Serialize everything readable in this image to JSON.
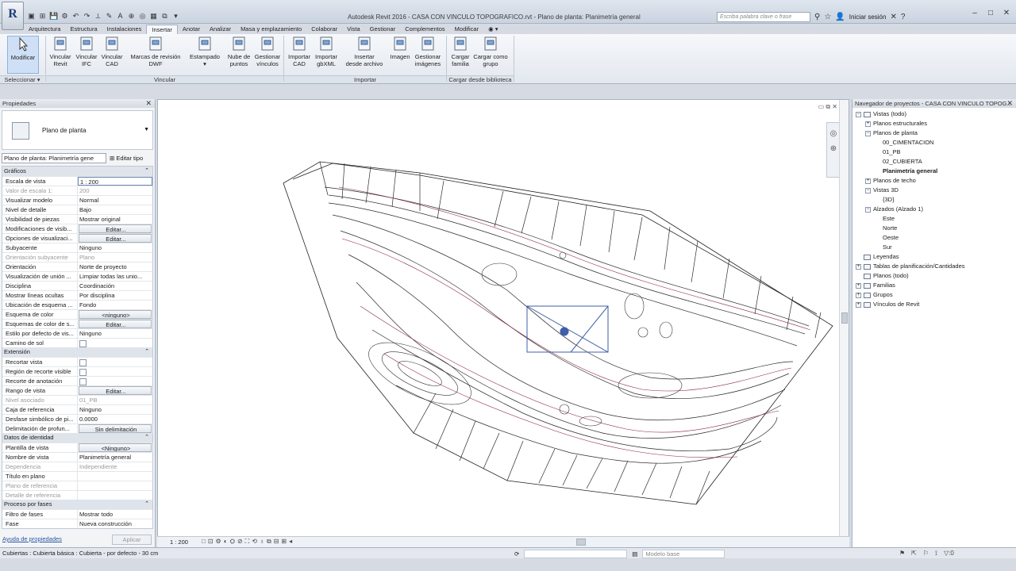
{
  "window": {
    "title": "Autodesk Revit 2016 -   CASA CON VINCULO TOPOGRAFICO.rvt - Plano de planta: Planimetría general",
    "logo": "R",
    "search_placeholder": "Escriba palabra clave o frase",
    "signin": "Iniciar sesión",
    "help": "?",
    "min": "–",
    "max": "□",
    "close": "✕"
  },
  "qat": [
    "▣",
    "⊞",
    "💾",
    "⚙",
    "↶",
    "↷",
    "⟂",
    "✎",
    "A",
    "⊕",
    "◎",
    "▦",
    "⧉",
    "▾"
  ],
  "tr_icons": [
    "⚲",
    "☆",
    "👤"
  ],
  "tabs": [
    "Arquitectura",
    "Estructura",
    "Instalaciones",
    "Insertar",
    "Anotar",
    "Analizar",
    "Masa y emplazamiento",
    "Colaborar",
    "Vista",
    "Gestionar",
    "Complementos",
    "Modificar",
    "◉ ▾"
  ],
  "active_tab": "Insertar",
  "ribbon": {
    "modify": "Modificar",
    "select_label": "Seleccionar ▾",
    "buttons": [
      {
        "l1": "Vincular",
        "l2": "Revit",
        "icon": "link-revit-icon"
      },
      {
        "l1": "Vincular",
        "l2": "IFC",
        "icon": "link-ifc-icon"
      },
      {
        "l1": "Vincular",
        "l2": "CAD",
        "icon": "link-cad-icon"
      },
      {
        "l1": "Marcas de revisión",
        "l2": "DWF",
        "icon": "dwf-markups-icon"
      },
      {
        "l1": "Estampado",
        "l2": "▾",
        "icon": "decal-icon"
      },
      {
        "l1": "Nube de",
        "l2": "puntos",
        "icon": "point-cloud-icon"
      },
      {
        "l1": "Gestionar",
        "l2": "vínculos",
        "icon": "manage-links-icon"
      },
      {
        "l1": "Importar",
        "l2": "CAD",
        "icon": "import-cad-icon"
      },
      {
        "l1": "Importar",
        "l2": "gbXML",
        "icon": "import-gbxml-icon"
      },
      {
        "l1": "Insertar",
        "l2": "desde archivo",
        "icon": "insert-file-icon"
      },
      {
        "l1": "Imagen",
        "l2": "",
        "icon": "image-icon"
      },
      {
        "l1": "Gestionar",
        "l2": "imágenes",
        "icon": "manage-images-icon"
      },
      {
        "l1": "Cargar",
        "l2": "familia",
        "icon": "load-family-icon"
      },
      {
        "l1": "Cargar como",
        "l2": "grupo",
        "icon": "load-group-icon"
      }
    ],
    "panels": {
      "vincular": "Vincular",
      "importar": "Importar",
      "cargar": "Cargar desde biblioteca"
    }
  },
  "properties": {
    "header": "Propiedades",
    "close": "✕",
    "type_name": "Plano de planta",
    "instance": "Plano de planta: Planimetría gene",
    "edit_type": "Editar tipo",
    "groups": [
      {
        "name": "Gráficos",
        "rows": [
          [
            "Escala de vista",
            "1 : 200",
            "sel"
          ],
          [
            "Valor de escala    1:",
            "200",
            "dim"
          ],
          [
            "Visualizar modelo",
            "Normal",
            ""
          ],
          [
            "Nivel de detalle",
            "Bajo",
            ""
          ],
          [
            "Visibilidad de piezas",
            "Mostrar original",
            ""
          ],
          [
            "Modificaciones de visib...",
            "Editar...",
            "btn"
          ],
          [
            "Opciones de visualizaci...",
            "Editar...",
            "btn"
          ],
          [
            "Subyacente",
            "Ninguno",
            ""
          ],
          [
            "Orientación subyacente",
            "Plano",
            "dim"
          ],
          [
            "Orientación",
            "Norte de proyecto",
            ""
          ],
          [
            "Visualización de unión ...",
            "Limpiar todas las unio...",
            ""
          ],
          [
            "Disciplina",
            "Coordinación",
            ""
          ],
          [
            "Mostrar líneas ocultas",
            "Por disciplina",
            ""
          ],
          [
            "Ubicación de esquema ...",
            "Fondo",
            ""
          ],
          [
            "Esquema de color",
            "<ninguno>",
            "btn"
          ],
          [
            "Esquemas de color de s...",
            "Editar...",
            "btn"
          ],
          [
            "Estilo por defecto de vis...",
            "Ninguno",
            ""
          ],
          [
            "Camino de sol",
            "",
            "chk"
          ]
        ]
      },
      {
        "name": "Extensión",
        "rows": [
          [
            "Recortar vista",
            "",
            "chk"
          ],
          [
            "Región de recorte visible",
            "",
            "chk"
          ],
          [
            "Recorte de anotación",
            "",
            "chk"
          ],
          [
            "Rango de vista",
            "Editar...",
            "btn"
          ],
          [
            "Nivel asociado",
            "01_PB",
            "dim"
          ],
          [
            "Caja de referencia",
            "Ninguno",
            ""
          ],
          [
            "Desfase simbólico de pi...",
            "0.0000",
            ""
          ],
          [
            "Delimitación de profun...",
            "Sin delimitación",
            "btn"
          ]
        ]
      },
      {
        "name": "Datos de identidad",
        "rows": [
          [
            "Plantilla de vista",
            "<Ninguno>",
            "btn"
          ],
          [
            "Nombre de vista",
            "Planimetría general",
            ""
          ],
          [
            "Dependencia",
            "Independiente",
            "dim"
          ],
          [
            "Título en plano",
            "",
            ""
          ],
          [
            "Plano de referencia",
            "",
            "dim"
          ],
          [
            "Detalle de referencia",
            "",
            "dim"
          ]
        ]
      },
      {
        "name": "Proceso por fases",
        "rows": [
          [
            "Filtro de fases",
            "Mostrar todo",
            ""
          ],
          [
            "Fase",
            "Nueva construcción",
            ""
          ]
        ]
      }
    ],
    "help": "Ayuda de propiedades",
    "apply": "Aplicar"
  },
  "canvas": {
    "view_ctl": "▭ ⧉ ✕",
    "scale": "1 : 200",
    "viewbar_icons": [
      "□",
      "⊡",
      "⚙",
      "◐",
      "⛭",
      "⊘",
      "⛶",
      "⟲",
      "♁",
      "⧉",
      "⊟",
      "⊞",
      "◂"
    ]
  },
  "browser": {
    "header": "Navegador de proyectos - CASA CON VINCULO TOPOG...",
    "close": "✕",
    "items": [
      {
        "t": "Vistas (todo)",
        "lvl": 0,
        "tg": "−",
        "ic": true
      },
      {
        "t": "Planos estructurales",
        "lvl": 1,
        "tg": "+"
      },
      {
        "t": "Planos de planta",
        "lvl": 1,
        "tg": "−"
      },
      {
        "t": "00_CIMENTACION",
        "lvl": 2
      },
      {
        "t": "01_PB",
        "lvl": 2
      },
      {
        "t": "02_CUBIERTA",
        "lvl": 2
      },
      {
        "t": "Planimetría general",
        "lvl": 2,
        "bold": true
      },
      {
        "t": "Planos de techo",
        "lvl": 1,
        "tg": "+"
      },
      {
        "t": "Vistas 3D",
        "lvl": 1,
        "tg": "−"
      },
      {
        "t": "{3D}",
        "lvl": 2
      },
      {
        "t": "Alzados (Alzado 1)",
        "lvl": 1,
        "tg": "−"
      },
      {
        "t": "Este",
        "lvl": 2
      },
      {
        "t": "Norte",
        "lvl": 2
      },
      {
        "t": "Oeste",
        "lvl": 2
      },
      {
        "t": "Sur",
        "lvl": 2
      },
      {
        "t": "Leyendas",
        "lvl": 0,
        "ic": true
      },
      {
        "t": "Tablas de planificación/Cantidades",
        "lvl": 0,
        "tg": "+",
        "ic": true
      },
      {
        "t": "Planos (todo)",
        "lvl": 0,
        "ic": true
      },
      {
        "t": "Familias",
        "lvl": 0,
        "tg": "+",
        "ic": true
      },
      {
        "t": "Grupos",
        "lvl": 0,
        "tg": "+",
        "ic": true
      },
      {
        "t": "Vínculos de Revit",
        "lvl": 0,
        "tg": "+",
        "ic": true
      }
    ]
  },
  "status": {
    "text": "Cubiertas : Cubierta básica : Cubierta - por defecto - 30 cm",
    "model": "Modelo base",
    "right_icons": [
      "⚑",
      "⇱",
      "⚐",
      "⟟",
      "▽:0"
    ],
    "sync": "⟳",
    "plan": "▤"
  }
}
